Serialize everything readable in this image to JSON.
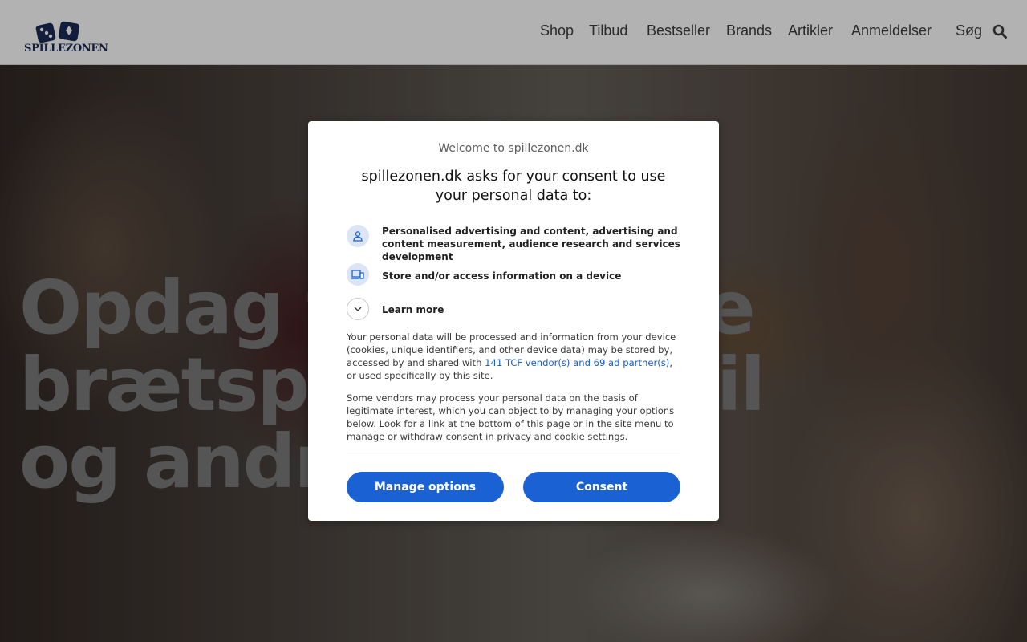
{
  "header": {
    "logo_text": "SPILLEZONEN",
    "nav": [
      "Shop",
      "Tilbud",
      "Bestseller",
      "Brands",
      "Artikler",
      "Anmeldelser"
    ],
    "search_label": "Søg"
  },
  "hero": {
    "title": "Opdag fantastiske brætspil, puslespil og andre spil"
  },
  "consent": {
    "welcome": "Welcome to spillezonen.dk",
    "heading": "spillezonen.dk asks for your consent to use your personal data to:",
    "purposes": [
      {
        "icon": "person-icon",
        "text": "Personalised advertising and content, advertising and content measurement, audience research and services development"
      },
      {
        "icon": "devices-icon",
        "text": "Store and/or access information on a device"
      }
    ],
    "learn_more": "Learn more",
    "para1_a": "Your personal data will be processed and information from your device (cookies, unique identifiers, and other device data) may be stored by, accessed by and shared with ",
    "para1_link": "141 TCF vendor(s) and 69 ad partner(s)",
    "para1_b": ", or used specifically by this site.",
    "para2": "Some vendors may process your personal data on the basis of legitimate interest, which you can object to by managing your options below. Look for a link at the bottom of this page or in the site menu to manage or withdraw consent in privacy and cookie settings.",
    "manage_label": "Manage options",
    "consent_label": "Consent"
  },
  "colors": {
    "accent": "#1a61d4",
    "logo": "#1b2a55"
  }
}
